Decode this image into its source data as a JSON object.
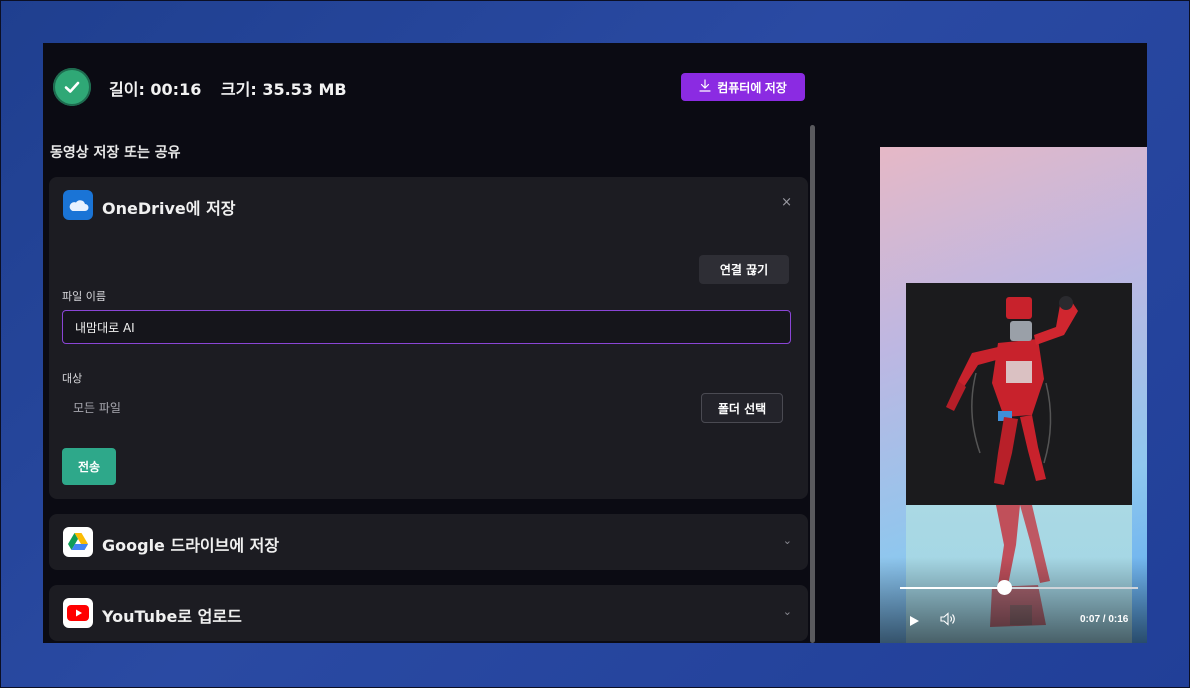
{
  "header": {
    "length_label": "길이: 00:16",
    "size_label": "크기: 35.53 MB",
    "save_pc_label": "컴퓨터에 저장"
  },
  "section_title": "동영상 저장 또는 공유",
  "onedrive": {
    "title": "OneDrive에 저장",
    "close_glyph": "×",
    "disconnect_label": "연결 끊기",
    "file_name_label": "파일 이름",
    "file_name_value": "내맘대로 AI",
    "destination_label": "대상",
    "destination_value": "모든 파일",
    "folder_select_label": "폴더 선택",
    "send_label": "전송"
  },
  "google_drive": {
    "title": "Google 드라이브에 저장",
    "chevron": "⌄"
  },
  "youtube": {
    "title": "YouTube로 업로드",
    "chevron": "⌄"
  },
  "player": {
    "time_label": "0:07 / 0:16",
    "progress": 0.44
  },
  "icons": {
    "check": "check-circle-icon",
    "download": "download-icon",
    "onedrive": "onedrive-cloud-icon",
    "google_drive": "google-drive-icon",
    "youtube": "youtube-icon",
    "play": "play-icon",
    "volume": "volume-icon"
  },
  "colors": {
    "accent_purple": "#8b2be2",
    "send_green": "#2ea88a",
    "check_green": "#2fa876",
    "card_bg": "#1c1c22",
    "app_bg": "#0b0b13"
  }
}
